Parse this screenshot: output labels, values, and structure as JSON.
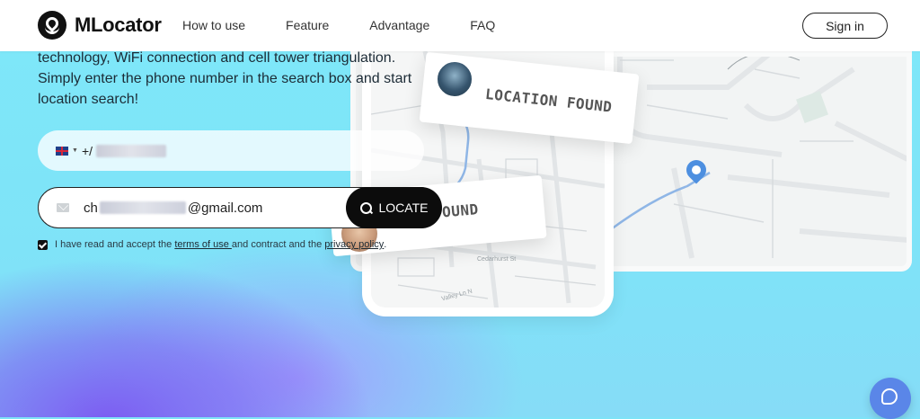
{
  "brand": {
    "name": "MLocator"
  },
  "nav": {
    "items": [
      {
        "label": "How to use"
      },
      {
        "label": "Feature"
      },
      {
        "label": "Advantage"
      },
      {
        "label": "FAQ"
      }
    ],
    "signin_label": "Sign in"
  },
  "hero": {
    "description": "technology, WiFi connection and cell tower triangulation. Simply enter the phone number in the search box and start location search!"
  },
  "phone_form": {
    "country": "flag-uk-icon",
    "prefix": "+/"
  },
  "email_form": {
    "value_start": "ch",
    "value_end": "@gmail.com",
    "locate_label": "LOCATE"
  },
  "consent": {
    "text_1": "I have read and accept the ",
    "terms_link": "terms of use ",
    "text_2": "and contract and the ",
    "privacy_link": "privacy policy",
    "text_3": ".",
    "checked": true
  },
  "map": {
    "card_primary": "LOCATION FOUND",
    "card_secondary": "ON FOUND",
    "streets": [
      "Cedarhurst St",
      "Valley Ln N"
    ],
    "pin_color": "#4d8fe0"
  },
  "colors": {
    "accent": "#0c0c0c",
    "background": "#7ee3f7",
    "chat": "#5a86e8"
  }
}
